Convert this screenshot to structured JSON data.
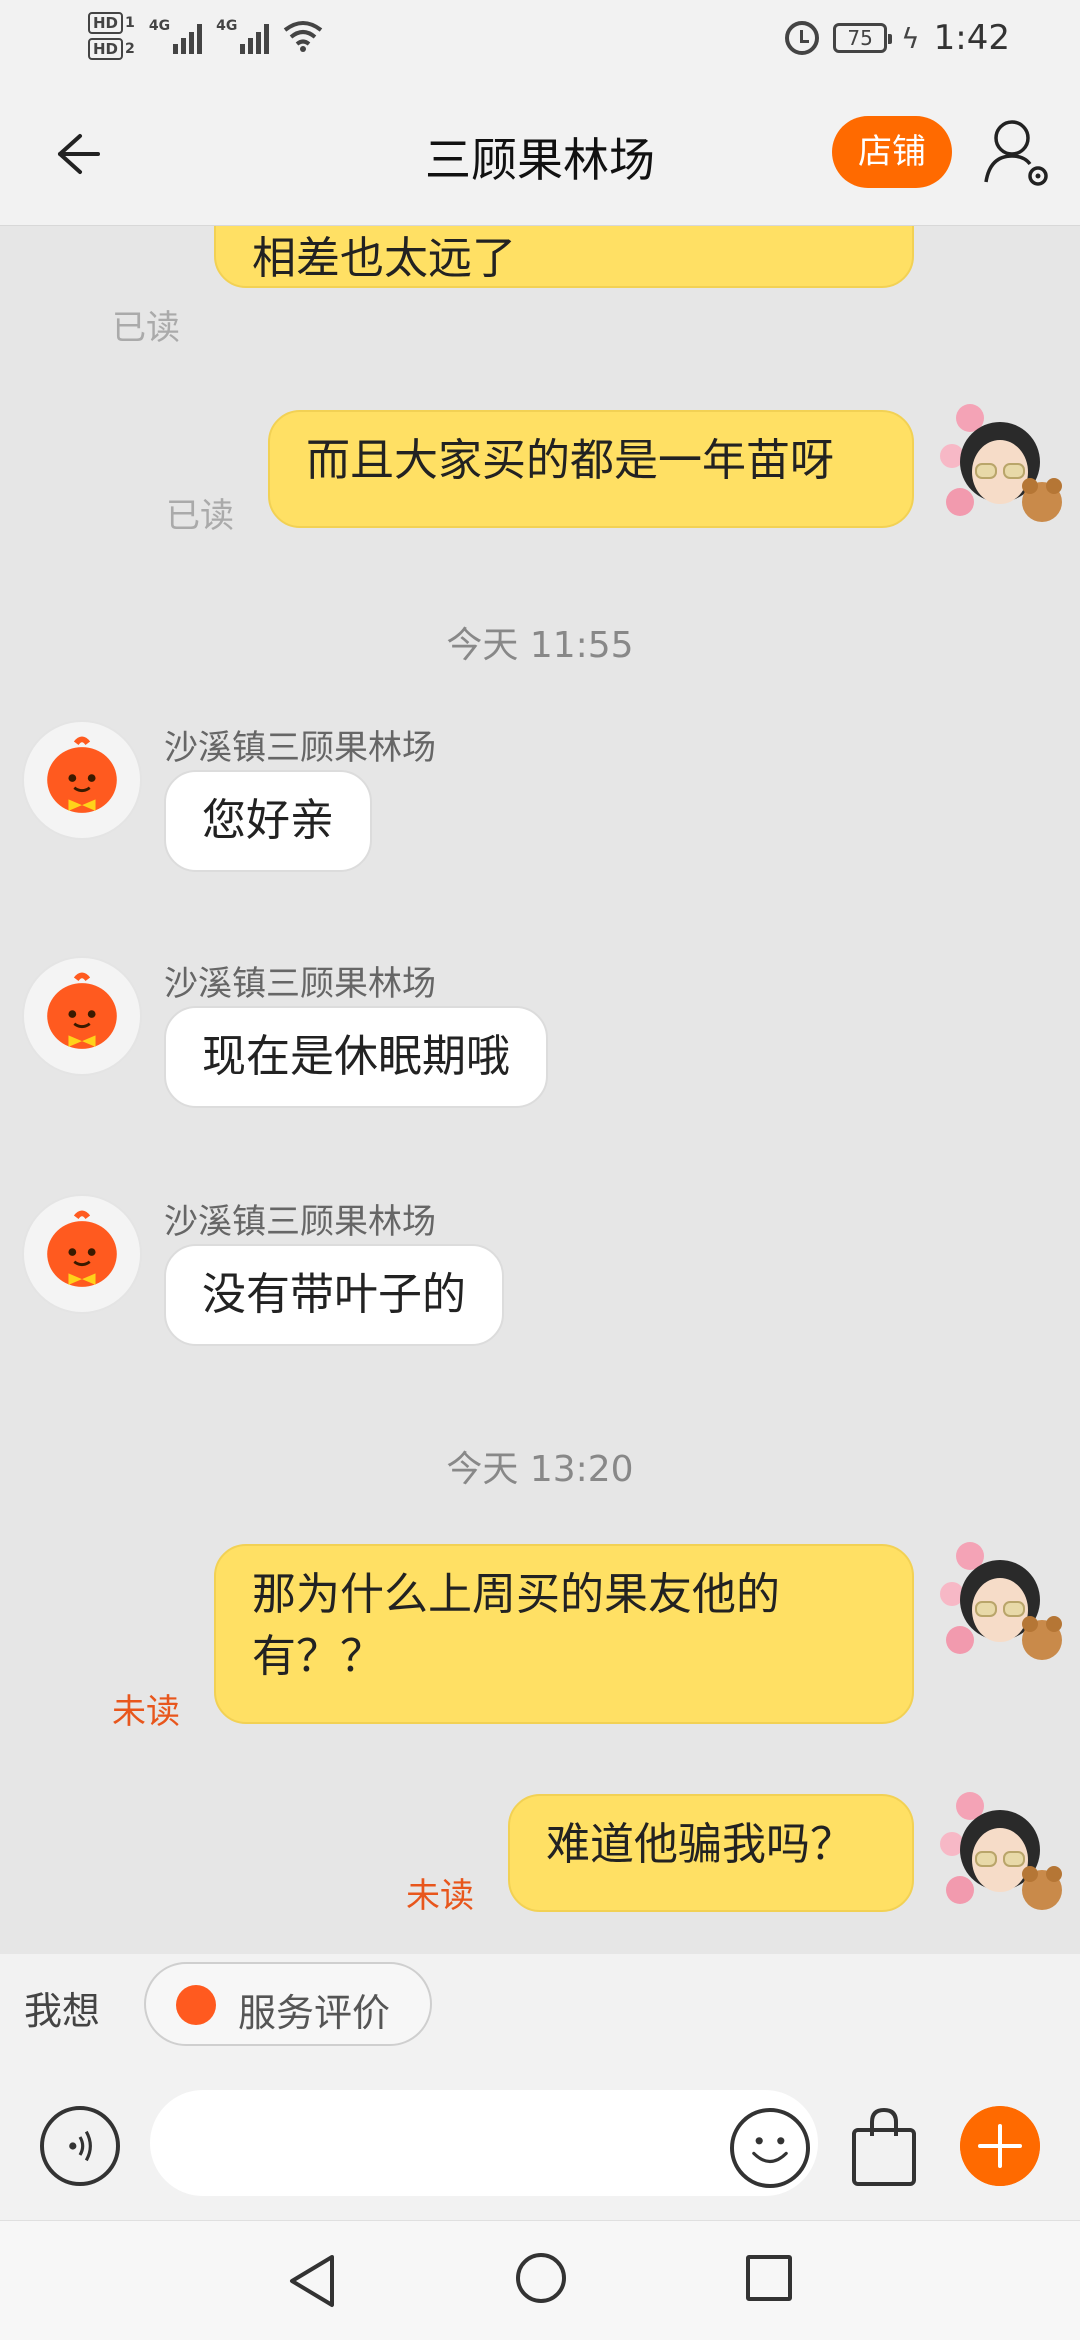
{
  "status_bar": {
    "hd1": "HD",
    "hd1_sub": "1",
    "hd2": "HD",
    "hd2_sub": "2",
    "net1": "4G",
    "net2": "4G",
    "battery": "75",
    "time": "1:42"
  },
  "header": {
    "title": "三顾果林场",
    "shop_button": "店铺"
  },
  "messages": [
    {
      "side": "me",
      "text": "没想到自己收到的是这样的，\n相差也太远了",
      "status": "已读"
    },
    {
      "side": "me",
      "text": "而且大家买的都是一年苗呀",
      "status": "已读"
    },
    {
      "time": "今天 11:55"
    },
    {
      "side": "them",
      "sender": "沙溪镇三顾果林场",
      "text": "您好亲"
    },
    {
      "side": "them",
      "sender": "沙溪镇三顾果林场",
      "text": "现在是休眠期哦"
    },
    {
      "side": "them",
      "sender": "沙溪镇三顾果林场",
      "text": "没有带叶子的"
    },
    {
      "time": "今天 13:20"
    },
    {
      "side": "me",
      "text": "那为什么上周买的果友他的\n有？？",
      "status": "未读"
    },
    {
      "side": "me",
      "text": "难道他骗我吗？",
      "status": "未读"
    }
  ],
  "quick_bar": {
    "label": "我想",
    "service_label": "服务评价"
  },
  "input_bar": {
    "placeholder": ""
  },
  "colors": {
    "accent": "#ff6a00",
    "my_bubble": "#ffe064",
    "unread": "#e8561c"
  }
}
